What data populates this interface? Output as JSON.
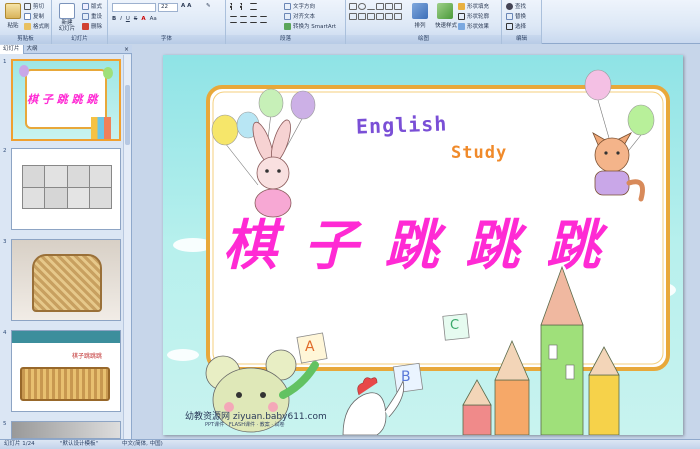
{
  "ribbon": {
    "clipboard": {
      "label": "剪贴板",
      "paste": "粘贴",
      "cut": "剪切",
      "copy": "复制",
      "format_painter": "格式刷"
    },
    "slides": {
      "label": "幻灯片",
      "new_slide": "新建\n幻灯片",
      "layout": "版式",
      "reset": "重设",
      "delete": "删除"
    },
    "font": {
      "label": "字体",
      "font_size": "22"
    },
    "paragraph": {
      "label": "段落",
      "text_direction": "文字方向",
      "align_text": "对齐文本",
      "smartart": "转换为 SmartArt"
    },
    "drawing": {
      "label": "绘图",
      "arrange": "排列",
      "quick_styles": "快速样式",
      "shape_fill": "形状填充",
      "shape_outline": "形状轮廓",
      "shape_effects": "形状效果"
    },
    "editing": {
      "label": "编辑",
      "find": "查找",
      "replace": "替换",
      "select": "选择"
    }
  },
  "panel": {
    "tab_slides": "幻灯片",
    "tab_outline": "大纲",
    "close": "×",
    "thumbs": [
      {
        "num": "1",
        "title": "棋 子 跳 跳 跳"
      },
      {
        "num": "2"
      },
      {
        "num": "3"
      },
      {
        "num": "4",
        "title": "棋子跳跳跳"
      },
      {
        "num": "5"
      }
    ]
  },
  "slide": {
    "english": "English",
    "study": "Study",
    "title": "棋 子 跳 跳 跳",
    "watermark": "幼教资源网 ziyuan.baby611.com",
    "watermark_sub": "PPT课件 · FLASH课件 · 教案 · 试卷",
    "letters": [
      "A",
      "B",
      "C"
    ]
  },
  "status": {
    "slide_info": "幻灯片 1/24",
    "theme": "\"默认设计模板\"",
    "language": "中文(简体, 中国)"
  },
  "colors": {
    "title": "#ff2ad4",
    "slide_bg": "#a8ece9",
    "frame": "#e8a83a",
    "ribbon": "#dde8f6"
  }
}
